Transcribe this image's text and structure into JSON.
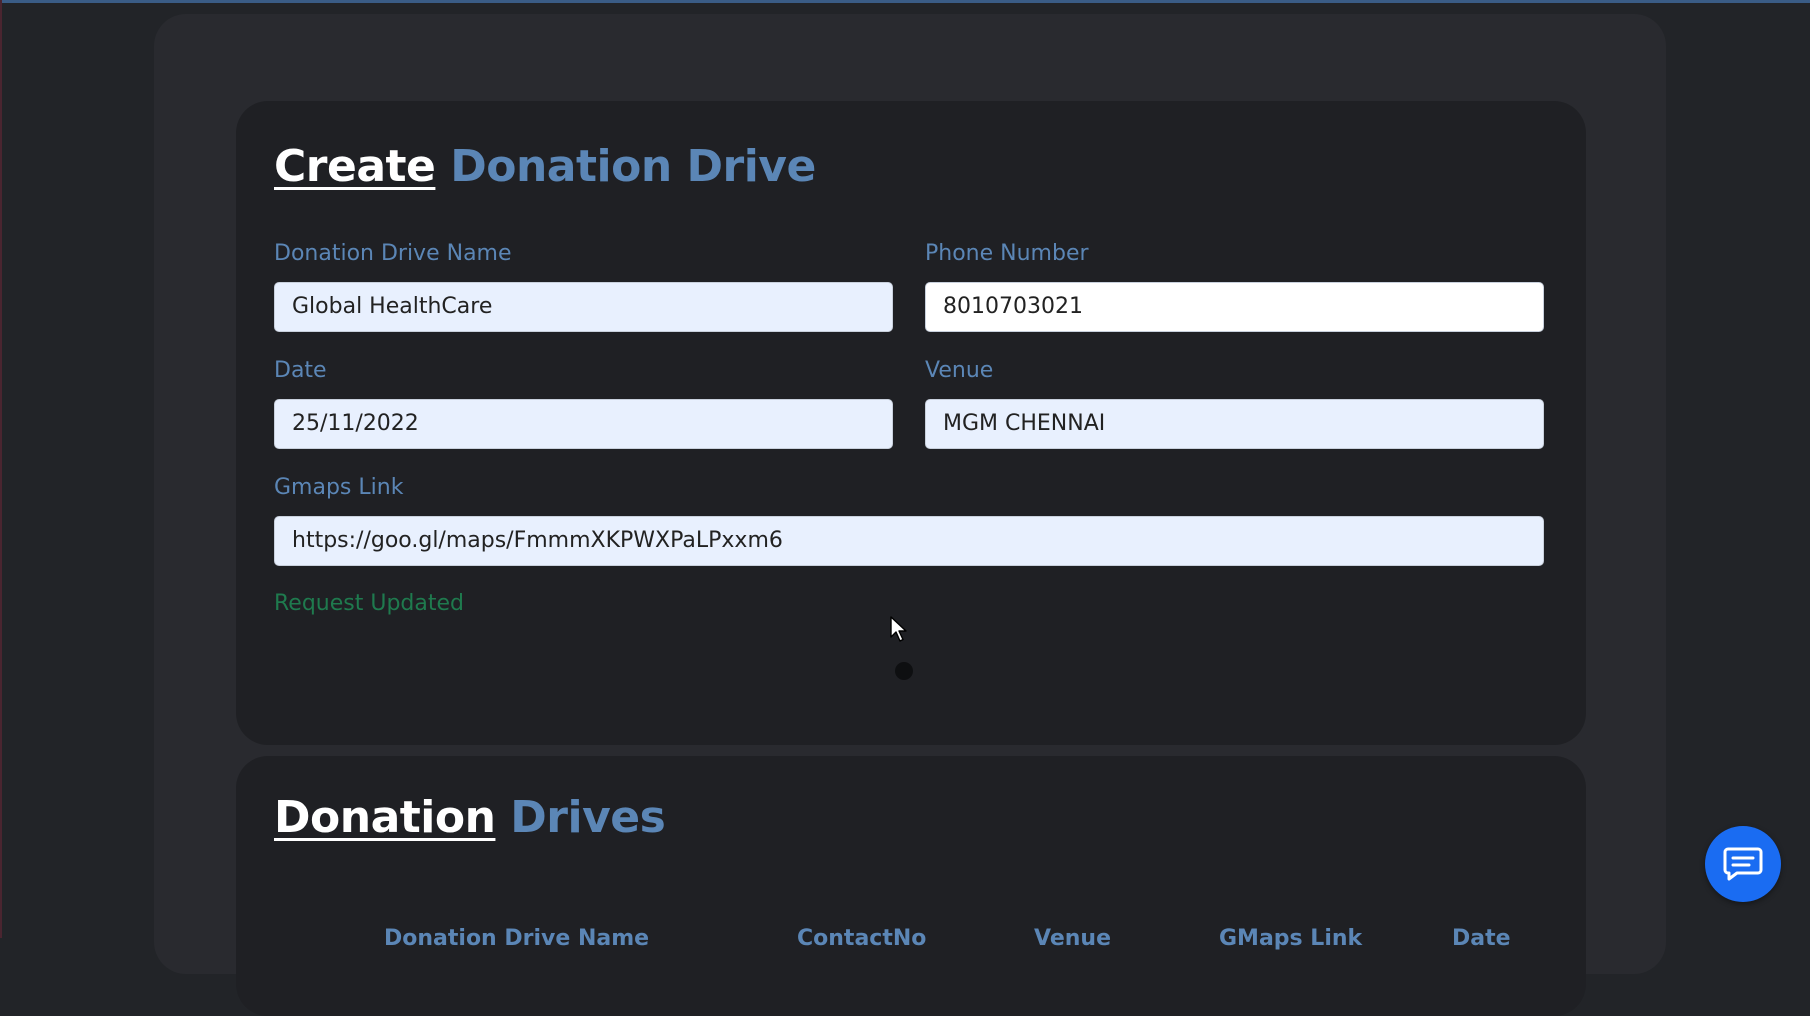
{
  "create_form": {
    "title_part1": "Create",
    "title_part2": "Donation Drive",
    "name_label": "Donation Drive Name",
    "name_value": "Global HealthCare",
    "phone_label": "Phone Number",
    "phone_value": "8010703021",
    "date_label": "Date",
    "date_value": "25/11/2022",
    "venue_label": "Venue",
    "venue_value": "MGM CHENNAI",
    "gmaps_label": "Gmaps Link",
    "gmaps_value": "https://goo.gl/maps/FmmmXKPWXPaLPxxm6",
    "status_message": "Request Updated"
  },
  "drives_list": {
    "title_part1": "Donation",
    "title_part2": "Drives",
    "columns": [
      "Donation Drive Name",
      "ContactNo",
      "Venue",
      "GMaps Link",
      "Date"
    ]
  },
  "colors": {
    "accent": "#5b86b6",
    "success": "#1f7a4e",
    "chat_button": "#1a6cf2"
  },
  "icons": {
    "chat": "chat-icon",
    "cursor": "mouse-cursor-icon"
  }
}
